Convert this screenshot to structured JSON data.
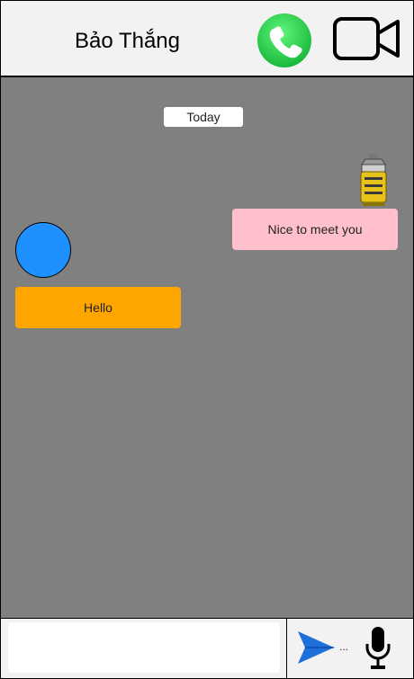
{
  "header": {
    "contact_name": "Bảo Thắng",
    "call_icon": "phone-icon",
    "video_icon": "video-camera-icon"
  },
  "chat": {
    "date_separator": "Today",
    "messages": [
      {
        "side": "right",
        "text": "Nice to meet you",
        "bubble_color": "#ffc0cb",
        "avatar": "robot-avatar-icon"
      },
      {
        "side": "left",
        "text": "Hello",
        "bubble_color": "#ffa500",
        "avatar_color": "#1e90ff"
      }
    ],
    "background_color": "#808080"
  },
  "composer": {
    "input_value": "",
    "input_placeholder": "",
    "send_icon": "send-icon",
    "overflow_text": "...",
    "mic_icon": "microphone-icon"
  }
}
